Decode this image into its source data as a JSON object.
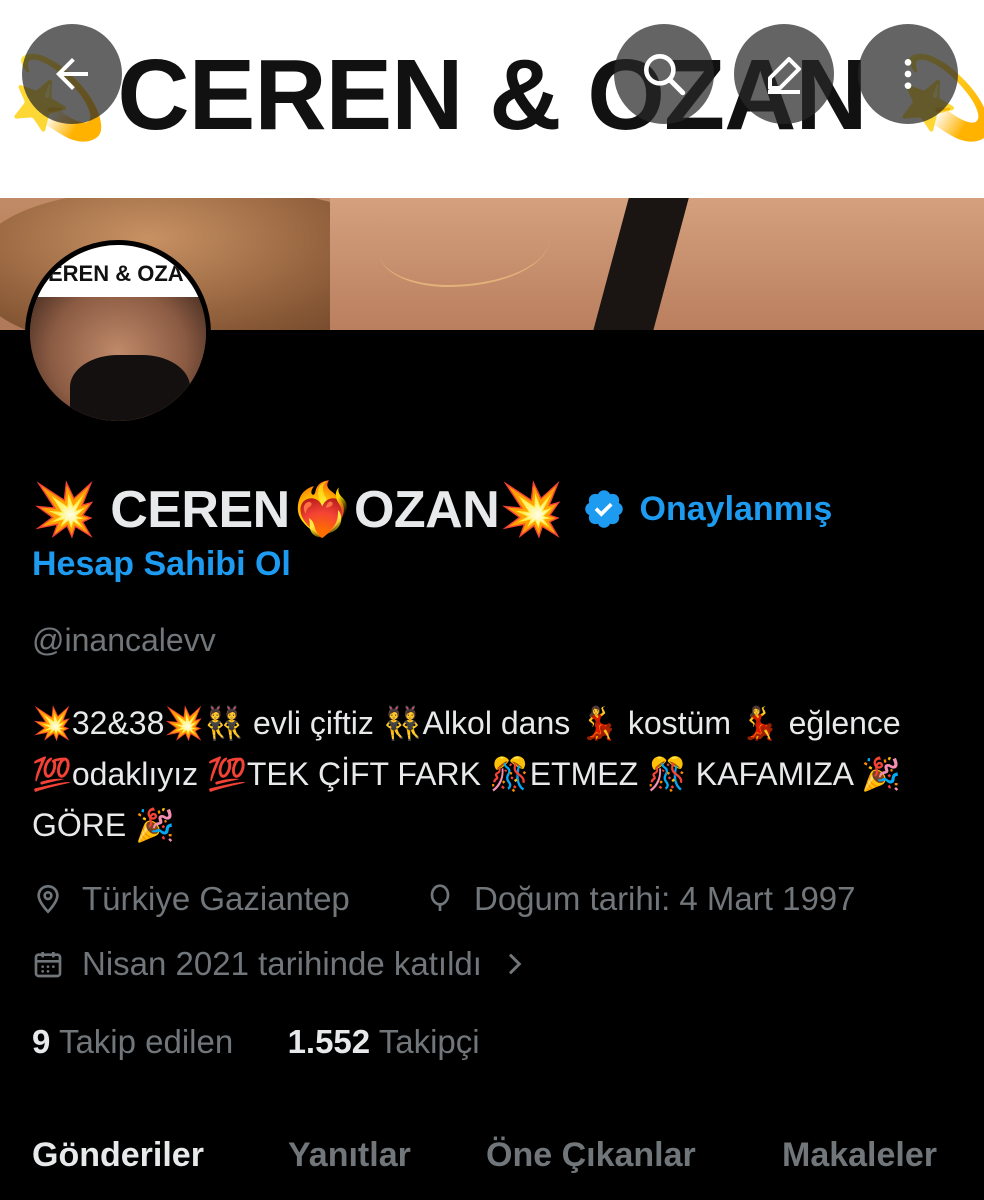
{
  "header": {
    "banner_text": "CEREN & OZAN",
    "back_icon": "arrow-left-icon",
    "search_icon": "search-icon",
    "edit_icon": "edit-icon",
    "more_icon": "more-vertical-icon"
  },
  "avatar": {
    "text": "EREN & OZA"
  },
  "profile": {
    "name": "💥 CEREN❤️‍🔥OZAN💥",
    "verified_label": "Onaylanmış",
    "verified_color": "#1d9bf0",
    "cta": "Hesap Sahibi Ol",
    "handle": "@inancalevv",
    "bio": "💥32&38💥👯 evli çiftiz 👯Alkol dans 💃 kostüm 💃 eğlence 💯odaklıyız 💯TEK ÇİFT FARK 🎊ETMEZ 🎊 KAFAMIZA 🎉GÖRE 🎉",
    "location": "Türkiye Gaziantep",
    "birthday": "Doğum tarihi: 4 Mart 1997",
    "joined": "Nisan 2021 tarihinde katıldı",
    "following_count": "9",
    "following_label": "Takip edilen",
    "followers_count": "1.552",
    "followers_label": "Takipçi"
  },
  "tabs": [
    "Gönderiler",
    "Yanıtlar",
    "Öne Çıkanlar",
    "Makaleler"
  ],
  "colors": {
    "background": "#000000",
    "text": "#e7e9ea",
    "muted": "#71767b",
    "accent": "#1d9bf0"
  }
}
